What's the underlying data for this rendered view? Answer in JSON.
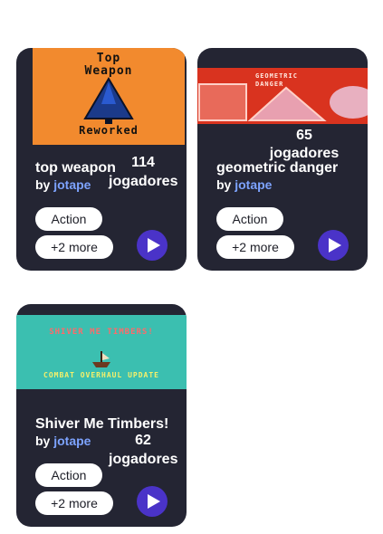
{
  "games": [
    {
      "thumb_lines": [
        "Top",
        "Weapon",
        "Reworked"
      ],
      "title": "top weapon",
      "by": "by",
      "author": "jotape",
      "players_count": "114",
      "players_label": "jogadores",
      "tag": "Action",
      "more": "+2 more"
    },
    {
      "thumb_lines": [
        "GEOMETRIC",
        "DANGER"
      ],
      "title": "geometric danger",
      "by": "by",
      "author": "jotape",
      "players_count": "65",
      "players_label": "jogadores",
      "tag": "Action",
      "more": "+2 more"
    },
    {
      "thumb_lines": [
        "SHIVER ME TIMBERS!",
        "COMBAT OVERHAUL UPDATE"
      ],
      "title": "Shiver Me Timbers!",
      "by": "by",
      "author": "jotape",
      "players_count": "62",
      "players_label": "jogadores",
      "tag": "Action",
      "more": "+2 more"
    }
  ],
  "colors": {
    "card_bg": "#242533",
    "play_button": "#4a33c8",
    "author_link": "#7da3ff",
    "thumb1_bg": "#f28a2e",
    "thumb2_bg": "#d9331f",
    "thumb3_bg": "#3bbfb0"
  },
  "icons": [
    "play-icon",
    "spaceship-icon",
    "pirate-ship-icon"
  ]
}
